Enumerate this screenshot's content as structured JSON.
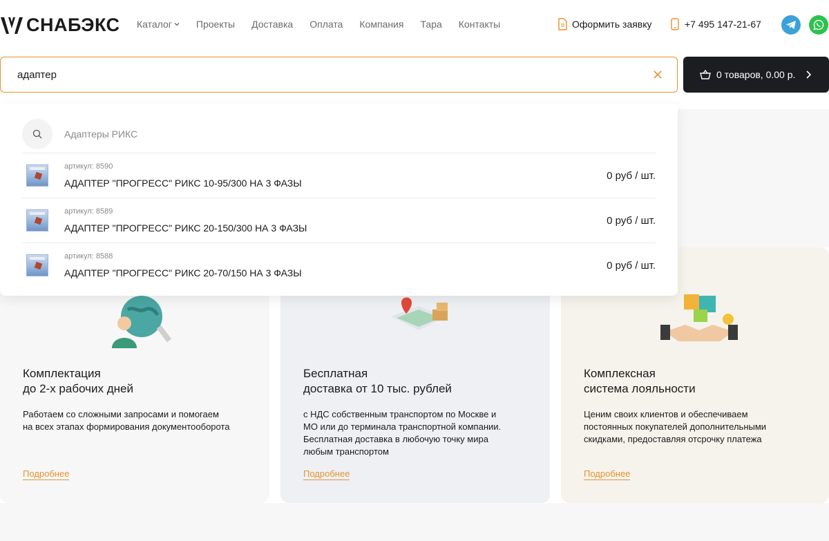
{
  "brand": {
    "name": "СНАБЭКС",
    "accent": "#e8912d"
  },
  "nav": {
    "items": [
      {
        "label": "Каталог",
        "has_dropdown": true
      },
      {
        "label": "Проекты"
      },
      {
        "label": "Доставка"
      },
      {
        "label": "Оплата"
      },
      {
        "label": "Компания"
      },
      {
        "label": "Тара"
      },
      {
        "label": "Контакты"
      }
    ]
  },
  "header": {
    "request_label": "Оформить заявку",
    "phone": "+7 495 147-21-67",
    "social": [
      "telegram-icon",
      "whatsapp-icon"
    ]
  },
  "search": {
    "value": "адаптер",
    "suggestion": "Адаптеры РИКС"
  },
  "cart": {
    "label": "0 товаров,  0.00 р."
  },
  "results": [
    {
      "sku": "артикул: 8590",
      "name": "АДАПТЕР \"ПРОГРЕСС\" РИКС 10-95/300 НА 3 ФАЗЫ",
      "price": "0 руб / шт."
    },
    {
      "sku": "артикул: 8589",
      "name": "АДАПТЕР \"ПРОГРЕСС\" РИКС 20-150/300 НА 3 ФАЗЫ",
      "price": "0 руб / шт."
    },
    {
      "sku": "артикул: 8588",
      "name": "АДАПТЕР \"ПРОГРЕСС\" РИКС 20-70/150 НА 3 ФАЗЫ",
      "price": "0 руб / шт."
    }
  ],
  "cards": [
    {
      "title": "Комплектация\nдо 2-х рабочих дней",
      "text": "Работаем со сложными запросами и помогаем\nна всех этапах формирования документооборота",
      "link": "Подробнее"
    },
    {
      "title": "Бесплатная\nдоставка от 10 тыс. рублей",
      "text": "с НДС собственным транспортом по Москве и\nМО или до терминала транспортной компании.\nБесплатная доставка в любочую точку мира\nлюбым транспортом",
      "link": "Подробнее"
    },
    {
      "title": "Комплексная\nсистема лояльности",
      "text": "Ценим своих клиентов и обеспечиваем\nпостоянных покупателей дополнительными\nскидками, предоставляя отсрочку платежа",
      "link": "Подробнее"
    }
  ]
}
